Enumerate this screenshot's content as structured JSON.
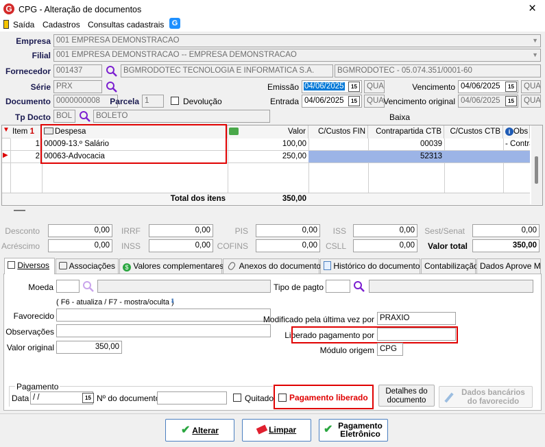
{
  "window": {
    "title": "CPG - Alteração de documentos",
    "close": "×"
  },
  "menu": {
    "saida": "Saída",
    "cadastros": "Cadastros",
    "consultas": "Consultas cadastrais"
  },
  "header": {
    "empresa_label": "Empresa",
    "empresa_value": "001 EMPRESA DEMONSTRACAO",
    "filial_label": "Filial",
    "filial_value": "001 EMPRESA DEMONSTRACAO -- EMPRESA DEMONSTRACAO",
    "fornecedor_label": "Fornecedor",
    "fornecedor_code": "001437",
    "fornecedor_name": "BGMRODOTEC TECNOLOGIA E INFORMATICA S.A.",
    "fornecedor_cnpj": "BGMRODOTEC - 05.074.351/0001-60",
    "serie_label": "Série",
    "serie_value": "PRX",
    "emissao_label": "Emissão",
    "emissao_value": "04/06/2025",
    "emissao_day": "QUA",
    "vencimento_label": "Vencimento",
    "vencimento_value": "04/06/2025",
    "vencimento_day": "QUA",
    "documento_label": "Documento",
    "documento_value": "0000000008",
    "parcela_label": "Parcela",
    "parcela_value": "1",
    "devolucao_label": "Devolução",
    "entrada_label": "Entrada",
    "entrada_value": "04/06/2025",
    "entrada_day": "QUA",
    "venc_original_label": "Vencimento original",
    "venc_original_value": "04/06/2025",
    "venc_original_day": "QUA",
    "tpdocto_label": "Tp Docto",
    "tpdocto_code": "BOL",
    "tpdocto_name": "BOLETO",
    "baixa_label": "Baixa",
    "cal_glyph": "15"
  },
  "grid": {
    "headers": {
      "item": "Item",
      "item_sort": "1",
      "despesa": "Despesa",
      "valor": "Valor",
      "cc_fin": "C/Custos FIN",
      "contrapartida": "Contrapartida CTB",
      "cc_ctb": "C/Custos CTB",
      "obs": "Obs"
    },
    "rows": [
      {
        "item": "1",
        "despesa": "00009-13.º Salário",
        "valor": "100,00",
        "contrapartida": "00039",
        "obs": "- Contra"
      },
      {
        "item": "2",
        "despesa": "00063-Advocacia",
        "valor": "250,00",
        "contrapartida": "52313",
        "obs": ""
      }
    ],
    "total_label": "Total dos itens",
    "total_value": "350,00"
  },
  "totals": {
    "desconto_label": "Desconto",
    "desconto": "0,00",
    "irrf_label": "IRRF",
    "irrf": "0,00",
    "pis_label": "PIS",
    "pis": "0,00",
    "iss_label": "ISS",
    "iss": "0,00",
    "sest_label": "Sest/Senat",
    "sest": "0,00",
    "acrescimo_label": "Acréscimo",
    "acrescimo": "0,00",
    "inss_label": "INSS",
    "inss": "0,00",
    "cofins_label": "COFINS",
    "cofins": "0,00",
    "csll_label": "CSLL",
    "csll": "0,00",
    "valor_total_label": "Valor total",
    "valor_total": "350,00"
  },
  "tabs": [
    "Diversos",
    "Associações",
    "Valores complementares",
    "Anexos do documento",
    "Histórico do documento",
    "Contabilização",
    "Dados Aprove Me"
  ],
  "diversos": {
    "moeda_label": "Moeda",
    "tipo_pagto_label": "Tipo de pagto",
    "hint": "( F6 - atualiza / F7 - mostra/oculta )",
    "favorecido_label": "Favorecido",
    "observacoes_label": "Observações",
    "valor_original_label": "Valor original",
    "valor_original": "350,00",
    "modificado_label": "Modificado pela última vez por",
    "modificado_value": "PRAXIO",
    "liberado_label": "Liberado pagamento por",
    "liberado_value": "",
    "modulo_label": "Módulo origem",
    "modulo_value": "CPG",
    "pagamento_group": "Pagamento",
    "data_label": "Data",
    "data_value": " /  /",
    "ndoc_label": "Nº do documento",
    "quitado_label": "Quitado",
    "pag_liberado_label": "Pagamento liberado",
    "detalhes_btn": [
      "Detalhes do",
      "documento"
    ],
    "dados_bancarios_btn": [
      "Dados bancários",
      "do favorecido"
    ]
  },
  "buttons": {
    "alterar": "Alterar",
    "limpar": "Limpar",
    "pag_eletronico_1": "Pagamento",
    "pag_eletronico_2": "Eletrônico"
  },
  "colors": {
    "accent": "#0078d7",
    "highlight_red": "#e00000",
    "selected_row": "#9cb4e6",
    "green_check": "#2aa640"
  }
}
